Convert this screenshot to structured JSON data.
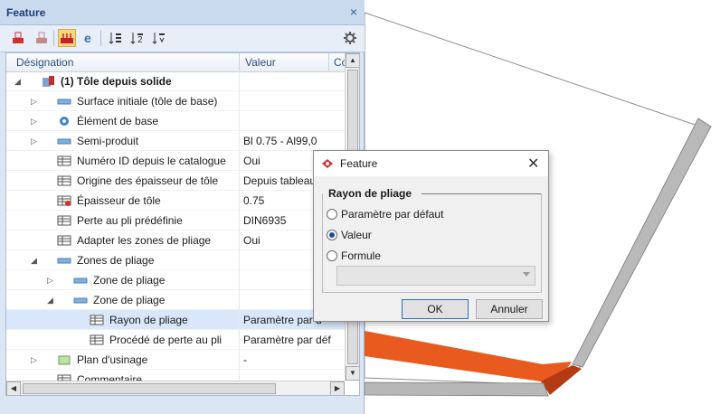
{
  "panel": {
    "title": "Feature",
    "close": "×"
  },
  "toolbar": {
    "icons": [
      "sheet-red-icon",
      "sheet-gray-icon",
      "sheet-active-icon",
      "e-icon",
      "sort-list-icon",
      "sort-2-icon",
      "sort-down-icon",
      "settings-gear-icon"
    ]
  },
  "grid": {
    "headers": {
      "name": "Désignation",
      "value": "Valeur",
      "col3": "Co"
    },
    "rows": [
      {
        "label": "(1) Tôle depuis solide",
        "value": ""
      },
      {
        "label": "Surface initiale (tôle de base)",
        "value": ""
      },
      {
        "label": "Élément de base",
        "value": ""
      },
      {
        "label": "Semi-produit",
        "value": "Bl 0.75 - Al99,0"
      },
      {
        "label": "Numéro ID depuis le catalogue",
        "value": "Oui"
      },
      {
        "label": "Origine des épaisseur de tôle",
        "value": "Depuis tableau"
      },
      {
        "label": "Épaisseur de tôle",
        "value": "0.75"
      },
      {
        "label": "Perte au pli prédéfinie",
        "value": "DIN6935"
      },
      {
        "label": "Adapter les zones de pliage",
        "value": "Oui"
      },
      {
        "label": "Zones de pliage",
        "value": ""
      },
      {
        "label": "Zone de pliage",
        "value": ""
      },
      {
        "label": "Zone de pliage",
        "value": ""
      },
      {
        "label": "Rayon de pliage",
        "value": "Paramètre par d"
      },
      {
        "label": "Procédé de perte au pli",
        "value": "Paramètre par déf"
      },
      {
        "label": "Plan d'usinage",
        "value": "-"
      },
      {
        "label": "Commentaire",
        "value": ""
      }
    ]
  },
  "dialog": {
    "title": "Feature",
    "close": "✕",
    "group_title": "Rayon de pliage",
    "options": [
      "Paramètre par défaut",
      "Valeur",
      "Formule"
    ],
    "selected": "Valeur",
    "formula_value": "",
    "ok": "OK",
    "cancel": "Annuler"
  },
  "colors": {
    "accent_orange": "#e0521a",
    "selection": "#d8e8fa",
    "header_text": "#1e3f78"
  }
}
